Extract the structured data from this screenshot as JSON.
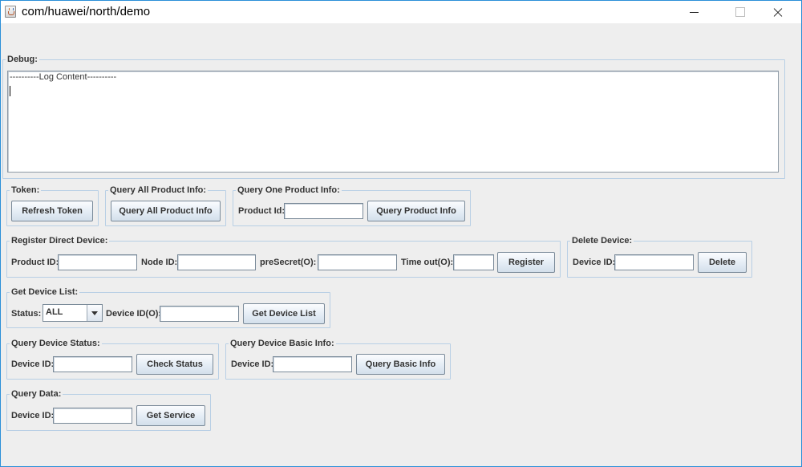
{
  "window": {
    "title": "com/huawei/north/demo",
    "controls": [
      "minimize",
      "maximize",
      "close"
    ]
  },
  "debug": {
    "title": "Debug:",
    "log_text": "----------Log Content----------"
  },
  "token": {
    "title": "Token:",
    "button": "Refresh Token"
  },
  "query_all_product": {
    "title": "Query All Product Info:",
    "button": "Query All Product Info"
  },
  "query_one_product": {
    "title": "Query One Product Info:",
    "product_id_label": "Product Id:",
    "product_id_value": "",
    "button": "Query Product Info"
  },
  "register_device": {
    "title": "Register Direct Device:",
    "product_id_label": "Product ID:",
    "product_id_value": "",
    "node_id_label": "Node ID:",
    "node_id_value": "",
    "presecret_label": "preSecret(O):",
    "presecret_value": "",
    "timeout_label": "Time out(O):",
    "timeout_value": "",
    "button": "Register"
  },
  "delete_device": {
    "title": "Delete Device:",
    "device_id_label": "Device ID:",
    "device_id_value": "",
    "button": "Delete"
  },
  "get_device_list": {
    "title": "Get Device List:",
    "status_label": "Status:",
    "status_selected": "ALL",
    "device_id_label": "Device ID(O):",
    "device_id_value": "",
    "button": "Get Device List"
  },
  "query_device_status": {
    "title": "Query Device Status:",
    "device_id_label": "Device ID:",
    "device_id_value": "",
    "button": "Check Status"
  },
  "query_device_basic": {
    "title": "Query Device Basic Info:",
    "device_id_label": "Device ID:",
    "device_id_value": "",
    "button": "Query Basic Info"
  },
  "query_data": {
    "title": "Query Data:",
    "device_id_label": "Device ID:",
    "device_id_value": "",
    "button": "Get Service"
  }
}
